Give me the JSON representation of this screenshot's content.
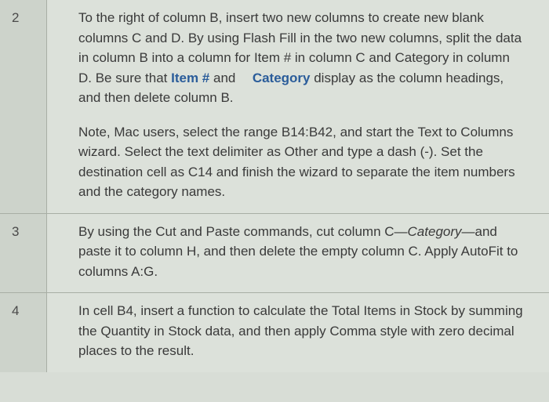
{
  "rows": [
    {
      "num": "2",
      "p1_a": "To the right of column B, insert two new columns to create new blank columns C and D. By using Flash Fill in the two new columns, split the data in column B into a column for Item # in column C and Category in column D. Be sure that ",
      "p1_link1": "Item #",
      "p1_b": " and ",
      "p1_link2": "Category",
      "p1_c": " display as the column headings, and then delete column B.",
      "p2": "Note, Mac users, select the range B14:B42, and start the Text to Columns wizard. Select the text delimiter as Other and type a dash (-). Set the destination cell as C14 and finish the wizard to separate the item numbers and the category names."
    },
    {
      "num": "3",
      "p1_a": "By using the Cut and Paste commands, cut column C—",
      "p1_i": "Category",
      "p1_b": "—and paste it to column H, and then delete the empty column C. Apply AutoFit to columns A:G."
    },
    {
      "num": "4",
      "p1": "In cell B4, insert a function to calculate the Total Items in Stock by summing the Quantity in Stock data, and then apply Comma style with zero decimal places to the result."
    }
  ]
}
